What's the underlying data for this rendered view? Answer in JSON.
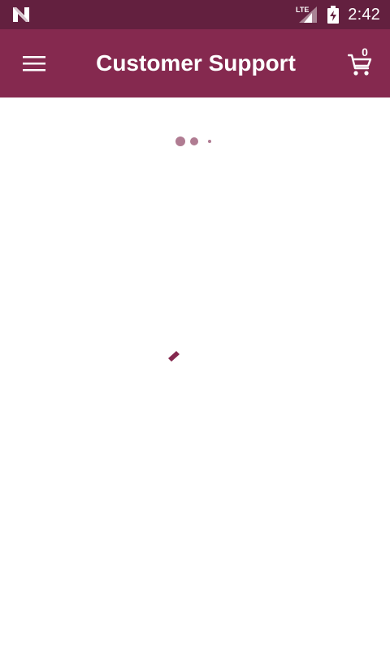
{
  "status_bar": {
    "notification_icon": "n-logo-icon",
    "network_label": "LTE",
    "signal_icon": "cell-signal-icon",
    "battery_icon": "battery-charging-icon",
    "time": "2:42",
    "color": "#63203f"
  },
  "app_bar": {
    "menu_icon": "hamburger-menu-icon",
    "title": "Customer Support",
    "cart_icon": "shopping-cart-icon",
    "cart_count": "0",
    "color": "#85294f"
  },
  "content": {
    "loading_dots_icon": "loading-dots-icon",
    "spinner_icon": "loading-spinner-icon",
    "accent": "#85294f"
  }
}
